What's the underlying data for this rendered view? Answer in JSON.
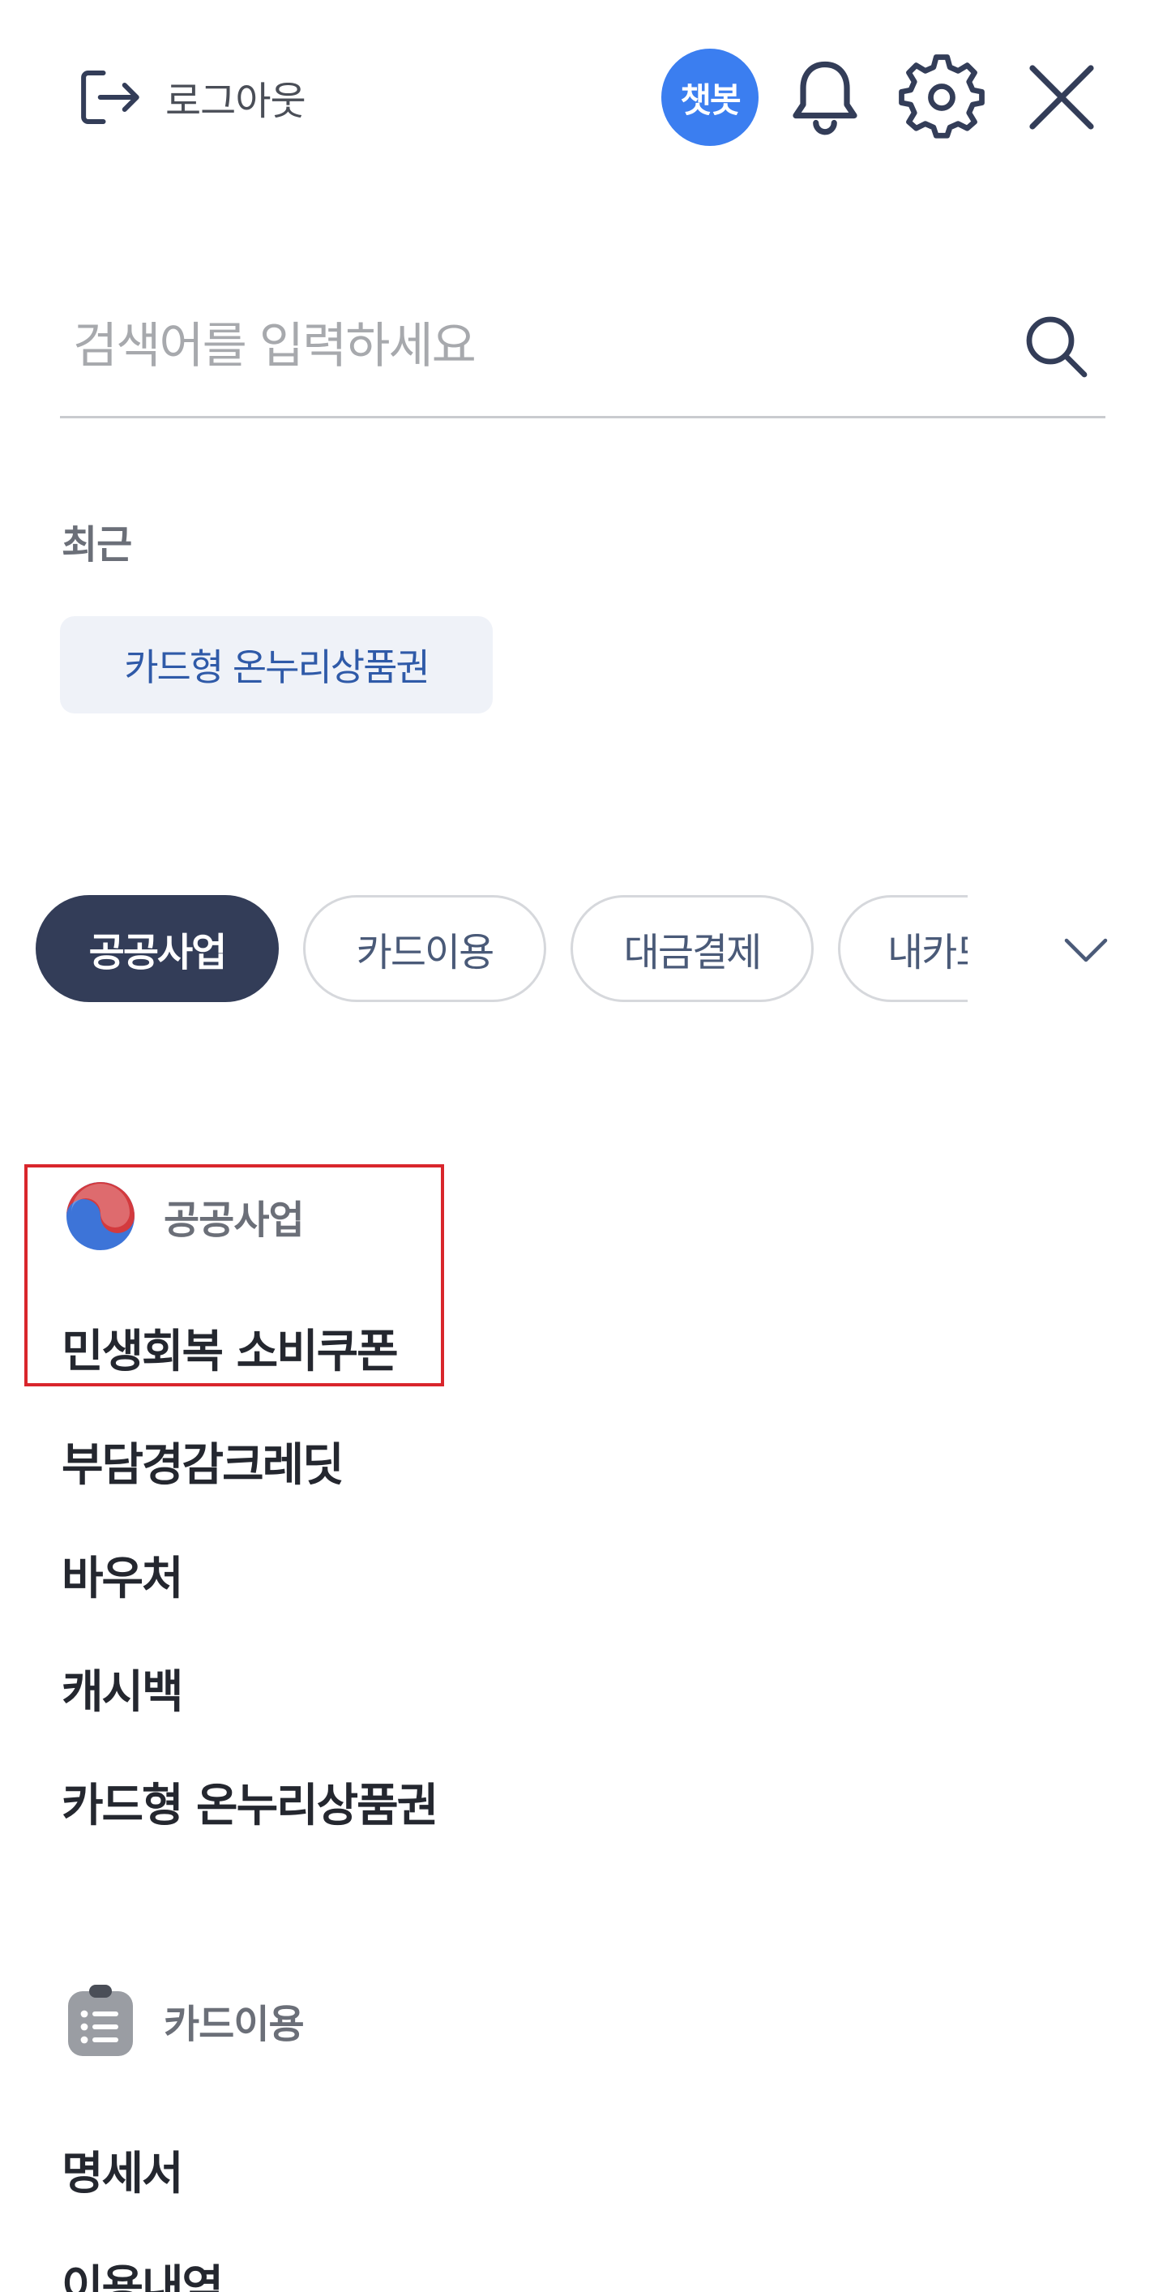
{
  "header": {
    "logout_label": "로그아웃",
    "chatbot_label": "챗봇",
    "icons": [
      "logout-icon",
      "bell-icon",
      "gear-icon",
      "close-icon"
    ]
  },
  "search": {
    "placeholder": "검색어를 입력하세요",
    "value": ""
  },
  "recent": {
    "title": "최근",
    "chips": [
      "카드형 온누리상품권"
    ]
  },
  "tabs": [
    {
      "label": "공공사업",
      "active": true
    },
    {
      "label": "카드이용",
      "active": false
    },
    {
      "label": "대금결제",
      "active": false
    },
    {
      "label": "내카드",
      "active": false
    }
  ],
  "sections": [
    {
      "title": "공공사업",
      "icon": "government-emblem-icon",
      "items": [
        "민생회복 소비쿠폰",
        "부담경감크레딧",
        "바우처",
        "캐시백",
        "카드형 온누리상품권"
      ]
    },
    {
      "title": "카드이용",
      "icon": "clipboard-list-icon",
      "items": [
        "명세서",
        "이용내역"
      ]
    }
  ],
  "colors": {
    "accent": "#3b7ef0",
    "active_tab": "#333d58",
    "chip_bg": "#eff2f8",
    "chip_text": "#2f5aa8",
    "highlight_border": "#d9262c"
  }
}
